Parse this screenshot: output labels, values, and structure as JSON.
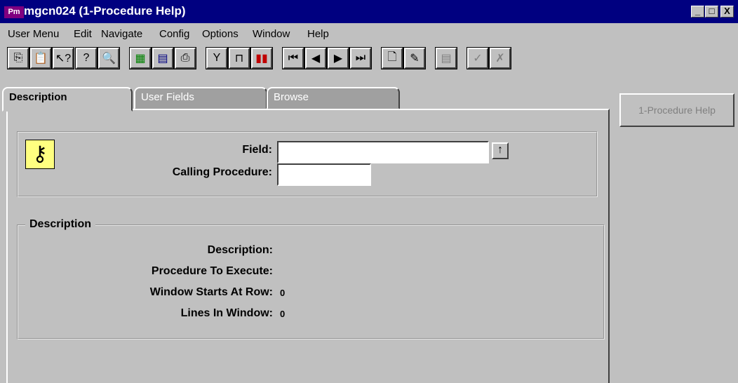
{
  "window": {
    "title": "mgcn024 (1-Procedure Help)",
    "app_icon_text": "Pm",
    "minimize": "_",
    "maximize": "□",
    "close": "X"
  },
  "menu": [
    "User Menu",
    "Edit",
    "Navigate",
    "Config",
    "Options",
    "Window",
    "Help"
  ],
  "toolbar": [
    {
      "name": "copy-icon",
      "glyph": "⎘"
    },
    {
      "name": "paste-icon",
      "glyph": "📋"
    },
    {
      "name": "query-icon",
      "glyph": "↖?"
    },
    {
      "name": "help-icon",
      "glyph": "?"
    },
    {
      "name": "spellcheck-icon",
      "glyph": "🔍"
    },
    {
      "name": "spreadsheet-icon",
      "glyph": "▦"
    },
    {
      "name": "calculator-icon",
      "glyph": "▤"
    },
    {
      "name": "print-icon",
      "glyph": "⎙"
    },
    {
      "name": "filter-icon",
      "glyph": "Y"
    },
    {
      "name": "sort-icon",
      "glyph": "⊓"
    },
    {
      "name": "chart-icon",
      "glyph": "▮▮"
    },
    {
      "name": "first-record-icon",
      "glyph": "⏮"
    },
    {
      "name": "previous-record-icon",
      "glyph": "◀"
    },
    {
      "name": "next-record-icon",
      "glyph": "▶"
    },
    {
      "name": "last-record-icon",
      "glyph": "⏭"
    },
    {
      "name": "new-record-icon",
      "glyph": "🗋"
    },
    {
      "name": "edit-record-icon",
      "glyph": "✎"
    },
    {
      "name": "insert-row-icon",
      "glyph": "▤"
    },
    {
      "name": "accept-icon",
      "glyph": "✓"
    },
    {
      "name": "cancel-icon",
      "glyph": "✗"
    }
  ],
  "tabs": [
    "Description",
    "User Fields",
    "Browse"
  ],
  "side_button": "1-Procedure Help",
  "key_section": {
    "field_label": "Field:",
    "calling_label": "Calling Procedure:",
    "field_value": "",
    "calling_value": "",
    "lookup_icon": "↑"
  },
  "desc_section": {
    "title": "Description",
    "description_label": "Description:",
    "procedure_label": "Procedure To Execute:",
    "window_row_label": "Window Starts At Row:",
    "window_row_value": "0",
    "lines_label": "Lines In Window:",
    "lines_value": "0"
  }
}
